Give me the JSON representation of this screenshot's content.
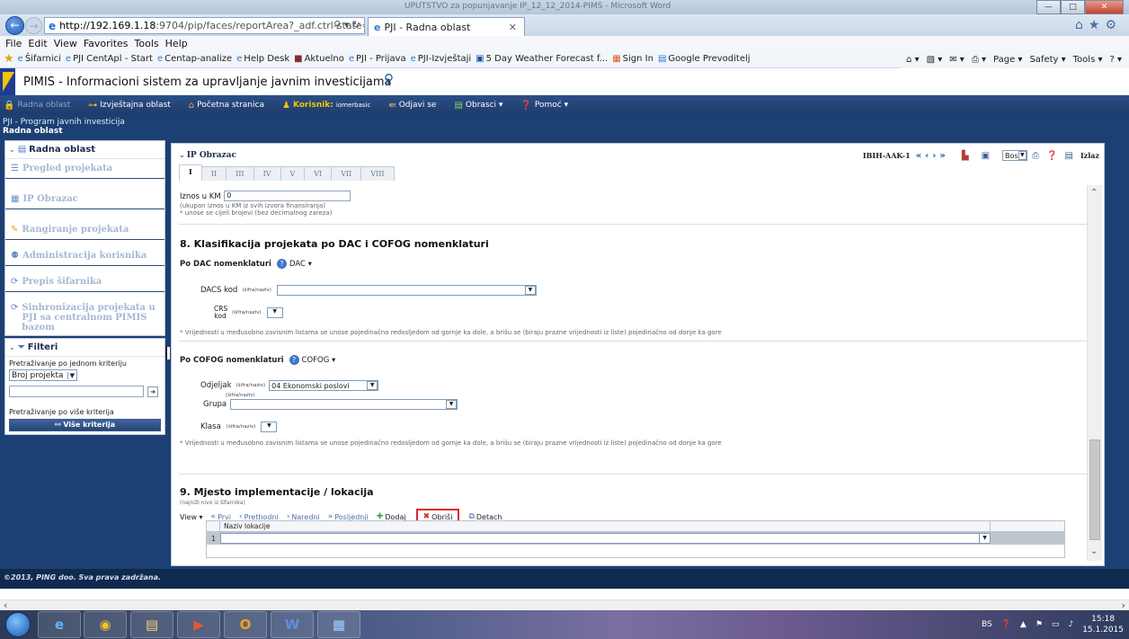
{
  "window": {
    "doc_title": "UPUTSTVO za popunjavanje IP_12_12_2014-PIMS - Microsoft Word",
    "min": "—",
    "max": "□",
    "close": "✕"
  },
  "browser": {
    "url_host": "http://192.169.1.18",
    "url_rest": ":9704/pip/faces/reportArea?_adf.ctrl-state=",
    "tab_title": "PJI - Radna oblast",
    "menu": [
      "File",
      "Edit",
      "View",
      "Favorites",
      "Tools",
      "Help"
    ],
    "favorites": [
      "Šifarnici",
      "PJI CentApl - Start",
      "Centap-analize",
      "Help Desk",
      "Aktuelno",
      "PJI - Prijava",
      "PJI-Izvještaji",
      "5 Day Weather Forecast f...",
      "Sign In",
      "Google Prevoditelj"
    ],
    "commands": [
      "Page ▾",
      "Safety ▾",
      "Tools ▾"
    ]
  },
  "app": {
    "title": "PIMIS - Informacioni sistem za upravljanje javnim investicijama",
    "toolbar": {
      "radna": "Radna oblast",
      "izvjestajna": "Izvještajna oblast",
      "pocetna": "Početna stranica",
      "korisnik_label": "Korisnik:",
      "korisnik_value": "iomerbasic",
      "odjavi": "Odjavi se",
      "obrasci": "Obrasci ▾",
      "pomoc": "Pomoć ▾"
    },
    "crumbs": [
      "PJI - Program javnih investicija",
      "Radna oblast"
    ],
    "sidebar": {
      "head": "Radna oblast",
      "items": [
        "Pregled projekata",
        "IP Obrazac",
        "Rangiranje projekata",
        "Administracija korisnika",
        "Prepis šifarnika",
        "Sinhronizacija projekata u PJI sa centralnom PIMIS bazom"
      ]
    },
    "filters": {
      "head": "Filteri",
      "single_label": "Pretraživanje po jednom kriteriju",
      "single_value": "Broj projekta",
      "multi_label": "Pretraživanje po više kriterija",
      "multi_button": "Više kriterija"
    },
    "footer": "©2013, PING doo. Sva prava zadržana."
  },
  "form": {
    "title": "IP Obrazac",
    "tabs": [
      "I",
      "II",
      "III",
      "IV",
      "V",
      "VI",
      "VII",
      "VIII"
    ],
    "record_id": "IBIH-AAK-1",
    "lang": "Bos",
    "exit": "Izlaz",
    "amount": {
      "label": "Iznos u KM",
      "value": "0",
      "note1": "(ukupan iznos u KM iz svih izvora finansiranja)",
      "note2": "* unose se cijeli brojevi (bez decimalnog zareza)"
    },
    "section8": {
      "title": "8. Klasifikacija projekata po DAC i COFOG nomenklaturi",
      "dac_label": "Po DAC nomenklaturi",
      "dac_menu": "DAC ▾",
      "dacs_label": "DACS kod",
      "crs_label": "CRS kod",
      "sifra": "(šifra/naziv)",
      "note": "* Vrijednosti u međusobno zavisnim listama se unose pojedinačno redosljedom od gornje ka dole, a brišu se (biraju prazne vrijednosti iz liste) pojedinačno od donje ka gore",
      "cofog_label": "Po COFOG nomenklaturi",
      "cofog_menu": "COFOG ▾",
      "odjeljak_label": "Odjeljak",
      "odjeljak_value": "04 Ekonomski poslovi",
      "grupa_label": "Grupa",
      "klasa_label": "Klasa"
    },
    "section9": {
      "title": "9. Mjesto implementacije / lokacija",
      "subtitle": "(najniži nivo iz šifarnika)",
      "view": "View ▾",
      "first": "Prvi",
      "prev": "Prethodni",
      "next": "Naredni",
      "last": "Posljednji",
      "add": "Dodaj",
      "delete": "Obriši",
      "detach": "Detach",
      "col_header": "Naziv lokacije",
      "row_num": "1"
    }
  },
  "taskbar": {
    "lang": "BS",
    "time": "15:18",
    "date": "15.1.2015",
    "apps": [
      "e",
      "◉",
      "▤",
      "▶",
      "O",
      "W",
      "▦"
    ]
  },
  "colors": {
    "brand_navy": "#1c4073",
    "highlight_red": "#e2242b",
    "flag_yellow": "#f2c300"
  }
}
